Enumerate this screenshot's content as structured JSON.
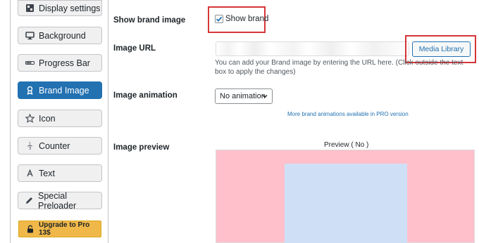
{
  "sidebar": {
    "items": [
      {
        "label": "Display settings",
        "icon": "display-settings-icon"
      },
      {
        "label": "Background",
        "icon": "monitor-icon"
      },
      {
        "label": "Progress Bar",
        "icon": "progress-bar-icon"
      },
      {
        "label": "Brand Image",
        "icon": "brand-image-icon",
        "active": true
      },
      {
        "label": "Icon",
        "icon": "star-icon"
      },
      {
        "label": "Counter",
        "icon": "fraction-icon"
      },
      {
        "label": "Text",
        "icon": "text-a-icon"
      },
      {
        "label": "Special Preloader",
        "icon": "pencil-icon"
      }
    ],
    "upgrade_label": "Upgrade to Pro 13$"
  },
  "settings": {
    "show_brand": {
      "label": "Show brand image",
      "checkbox_label": "Show brand",
      "checked": true
    },
    "image_url": {
      "label": "Image URL",
      "value": "",
      "button_label": "Media Library",
      "help": "You can add your Brand image by entering the URL here. (Click outside the text box to apply the changes)"
    },
    "image_animation": {
      "label": "Image animation",
      "selected": "No animation",
      "pro_note": "More brand animations available in PRO version"
    },
    "image_preview": {
      "label": "Image preview",
      "preview_title": "Preview ( No )"
    }
  },
  "colors": {
    "accent": "#2271b1",
    "highlight": "#d63638",
    "preview_bg": "#ffc0cb",
    "preview_inner": "#cfe0f6",
    "upgrade": "#f0b849"
  }
}
